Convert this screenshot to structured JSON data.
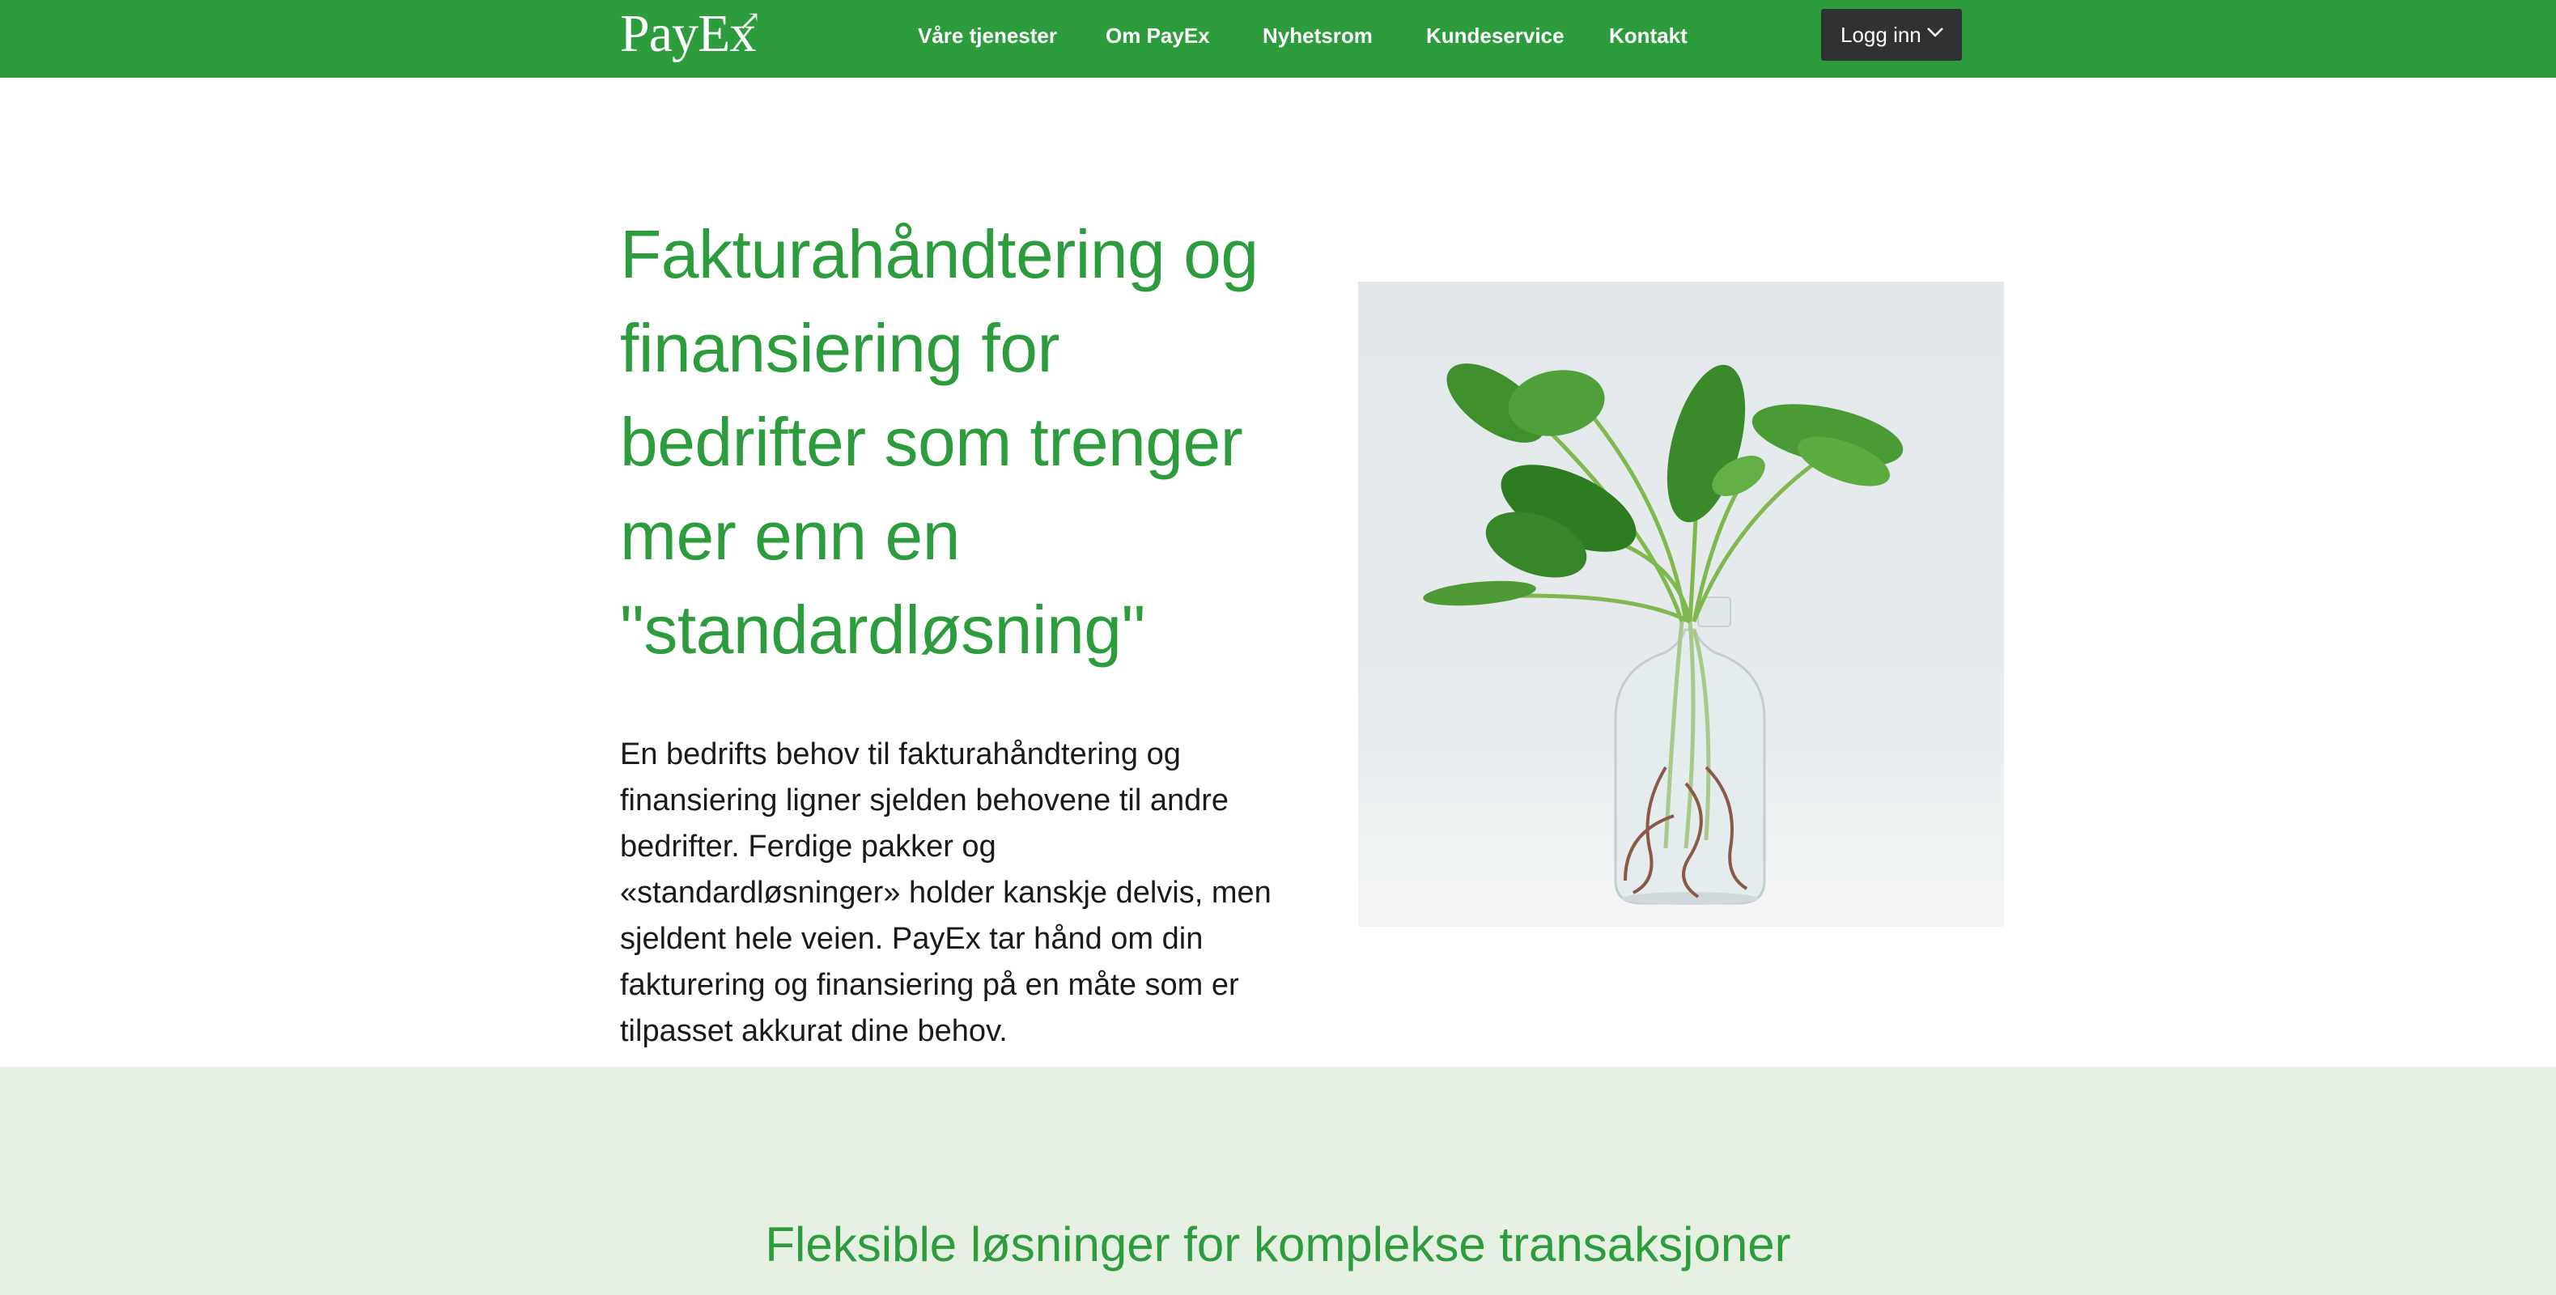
{
  "header": {
    "logo_text": "PayEx",
    "nav": [
      {
        "label": "Våre tjenester"
      },
      {
        "label": "Om PayEx"
      },
      {
        "label": "Nyhetsrom"
      },
      {
        "label": "Kundeservice"
      },
      {
        "label": "Kontakt"
      }
    ],
    "login_label": "Logg inn"
  },
  "hero": {
    "title": "Fakturahåndtering og finansiering for bedrifter som trenger mer enn en \"standardløsning\"",
    "body": "En bedrifts behov til fakturahåndtering og finansiering ligner sjelden behovene til andre bedrifter. Ferdige pakker og «standardløsninger» holder kanskje delvis, men sjeldent hele veien. PayEx tar hånd om din fakturering og finansiering på en måte som er tilpasset akkurat dine behov."
  },
  "section2": {
    "title": "Fleksible løsninger for komplekse transaksjoner"
  },
  "colors": {
    "brand_green": "#2c9c3d",
    "login_bg": "#2f3133",
    "section_bg": "#e6f0e3"
  },
  "icons": {
    "login_chevron": "chevron-down-icon"
  }
}
